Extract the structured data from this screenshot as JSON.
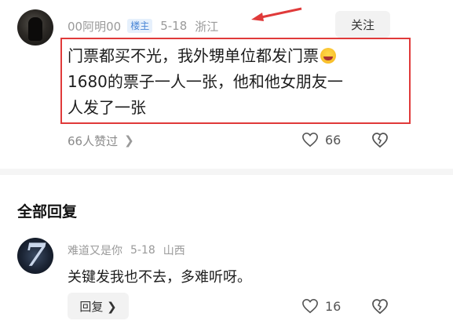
{
  "comment": {
    "username": "00阿明00",
    "badge": "楼主",
    "date": "5-18",
    "location": "浙江",
    "follow_label": "关注",
    "line1": "门票都买不光，我外甥单位都发门票",
    "line2": "1680的票子一人一张，他和他女朋友一",
    "line3": "人发了一张",
    "likes_link": "66人赞过",
    "like_count": "66"
  },
  "section": {
    "title": "全部回复"
  },
  "reply": {
    "username": "难道又是你",
    "date": "5-18",
    "location": "山西",
    "text": "关键发我也不去，多难听呀。",
    "reply_button_label": "回复",
    "like_count": "16"
  },
  "colors": {
    "highlight_border": "#e03a3a",
    "badge_bg": "#e6f0fc",
    "badge_text": "#4a86d6",
    "meta_text": "#9a9a9a"
  },
  "icons": [
    "heart-icon",
    "dislike-icon",
    "chevron-right-icon",
    "red-arrow",
    "laughing-emoji"
  ]
}
